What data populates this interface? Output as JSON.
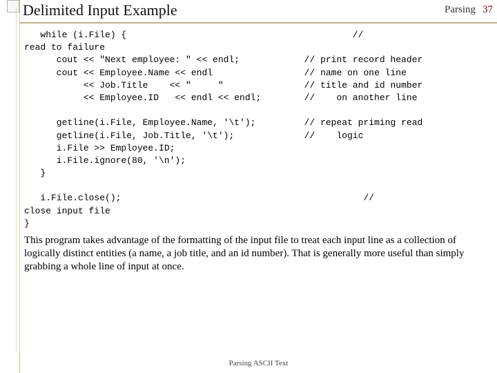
{
  "header": {
    "title": "Delimited Input Example",
    "topic": "Parsing",
    "page_number": "37"
  },
  "code": "   while (i.File) {                                          //\nread to failure\n      cout << \"Next employee: \" << endl;            // print record header\n      cout << Employee.Name << endl                 // name on one line\n           << Job.Title    << \"     \"               // title and id number\n           << Employee.ID   << endl << endl;        //    on another line\n\n      getline(i.File, Employee.Name, '\\t');         // repeat priming read\n      getline(i.File, Job.Title, '\\t');             //    logic\n      i.File >> Employee.ID;\n      i.File.ignore(80, '\\n');\n   }\n\n   i.File.close();                                             //\nclose input file\n}",
  "body": "This program takes advantage of the formatting of the input file to treat each input line as a collection of logically distinct entities (a name, a job title, and an id number).  That is generally more useful than simply grabbing a whole line of input at once.",
  "footer": "Parsing ASCII Text"
}
